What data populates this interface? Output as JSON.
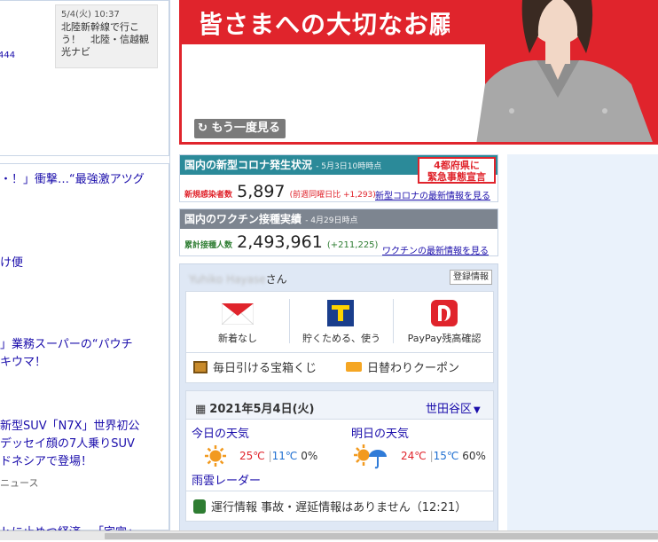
{
  "left": {
    "topic": {
      "date": "5/4(火) 10:37",
      "text": "北陸新幹線で行こう！　北陸・信越観光ナビ"
    },
    "side_number": "444",
    "news": [
      {
        "text": "・！」衝撃…“最強激アツグ"
      },
      {
        "text": "け便"
      },
      {
        "text": "」業務スーパーの“パウチ"
      },
      {
        "text": "キウマ！"
      },
      {
        "text": "新型SUV「N7X」世界初公"
      },
      {
        "text": "デッセイ顔の7人乗りSUV"
      },
      {
        "text": "ドネシアで登場！"
      },
      {
        "text": "ニュース"
      },
      {
        "text": "ｋに止めつ経済…「宅完」"
      }
    ]
  },
  "video": {
    "title": "皆さまへの大切なお願い",
    "replay_label": "もう一度見る"
  },
  "covid": {
    "title": "国内の新型コロナ発生状況",
    "as_of": "- 5月3日10時時点",
    "alert_line1": "4都府県に",
    "alert_line2": "緊急事態宣言",
    "cases_label": "新規感染者数",
    "cases_value": "5,897",
    "cases_change": "(前週同曜日比 +1,293)",
    "more_link": "新型コロナの最新情報を見る"
  },
  "vaccine": {
    "title": "国内のワクチン接種実績",
    "as_of": "- 4月29日時点",
    "label": "累計接種人数",
    "value": "2,493,961",
    "change": "(+211,225)",
    "more_link": "ワクチンの最新情報を見る"
  },
  "user": {
    "name": "Yuhiko Hayase",
    "suffix": "さん",
    "account_button": "登録情報",
    "services": [
      {
        "label": "新着なし",
        "icon": "mail-icon"
      },
      {
        "label": "貯くためる、使う",
        "icon": "tpoint-icon"
      },
      {
        "label": "PayPay残高確認",
        "icon": "paypay-icon"
      }
    ],
    "lottery": "毎日引ける宝箱くじ",
    "coupon": "日替わりクーポン"
  },
  "weather": {
    "date": "2021年5月4日(火)",
    "location": "世田谷区",
    "today_label": "今日の天気",
    "today_high": "25℃",
    "today_low": "11℃",
    "today_rain": "0%",
    "tomorrow_label": "明日の天気",
    "tomorrow_high": "24℃",
    "tomorrow_low": "15℃",
    "tomorrow_rain": "60%",
    "radar_link": "雨雲レーダー"
  },
  "transit": {
    "label": "運行情報",
    "status": "事故・遅延情報はありません（12:21）"
  },
  "colors": {
    "accent_red": "#e0242c",
    "covid_teal": "#2b8a99",
    "vaccine_gray": "#7d8590",
    "high_temp": "#e0242c",
    "low_temp": "#1f6fd1",
    "link": "#1a0dab"
  }
}
